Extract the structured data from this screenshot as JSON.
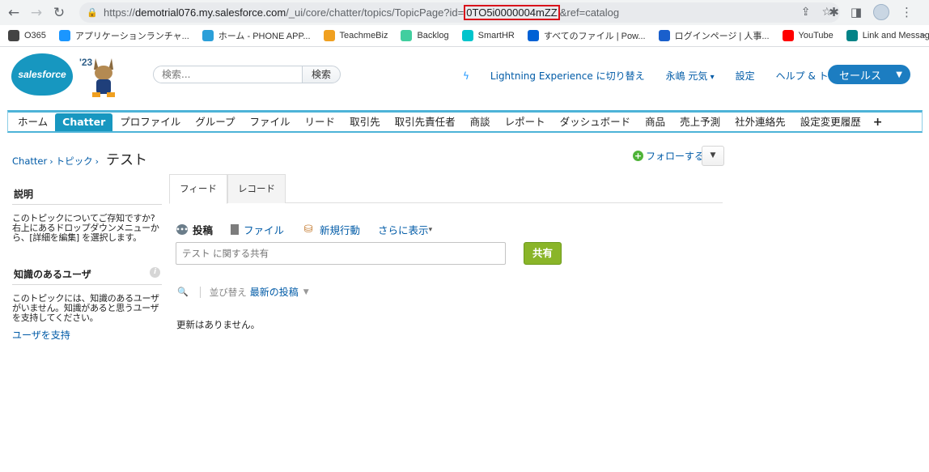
{
  "browser": {
    "url_prefix": "https://",
    "url_host": "demotrial076.my.salesforce.com",
    "url_path": "/_ui/core/chatter/topics/TopicPage?id=",
    "url_id": "0TO5i0000004mZZ",
    "url_suffix": "&ref=catalog"
  },
  "bookmarks": [
    {
      "label": "O365",
      "icon": "office-icon",
      "color": "#444444"
    },
    {
      "label": "アプリケーションランチャ...",
      "icon": "cloud-icon",
      "color": "#1b96ff"
    },
    {
      "label": "ホーム - PHONE APP...",
      "icon": "grid-icon",
      "color": "#2b9fd9"
    },
    {
      "label": "TeachmeBiz",
      "icon": "teachme-icon",
      "color": "#f0a020"
    },
    {
      "label": "Backlog",
      "icon": "backlog-icon",
      "color": "#42ce9f"
    },
    {
      "label": "SmartHR",
      "icon": "smarthr-icon",
      "color": "#00c4cc"
    },
    {
      "label": "すべてのファイル | Pow...",
      "icon": "box-icon",
      "color": "#0061d5"
    },
    {
      "label": "ログインページ | 人事...",
      "icon": "arrow-icon",
      "color": "#1a5fcc"
    },
    {
      "label": "YouTube",
      "icon": "youtube-icon",
      "color": "#ff0000"
    },
    {
      "label": "Link and Message P...",
      "icon": "sharepoint-icon",
      "color": "#038387"
    }
  ],
  "header": {
    "logo_text": "salesforce",
    "year": "'23",
    "search_placeholder": "検索...",
    "search_button": "検索",
    "lightning_link": "Lightning Experience に切り替え",
    "user_name": "永嶋 元気",
    "settings": "設定",
    "help": "ヘルプ & トレーニング",
    "app_name": "セールス"
  },
  "tabs": [
    "ホーム",
    "Chatter",
    "プロファイル",
    "グループ",
    "ファイル",
    "リード",
    "取引先",
    "取引先責任者",
    "商談",
    "レポート",
    "ダッシュボード",
    "商品",
    "売上予測",
    "社外連絡先",
    "設定変更履歴"
  ],
  "active_tab": "Chatter",
  "breadcrumb": {
    "crumb1": "Chatter",
    "crumb2": "トピック",
    "sep": "›",
    "title": "テスト"
  },
  "follow_label": "フォローする",
  "sidebar": {
    "desc_title": "説明",
    "desc_text": "このトピックについてご存知ですか? 右上にあるドロップダウンメニューから、[詳細を編集] を選択します。",
    "knowledge_title": "知識のあるユーザ",
    "knowledge_text": "このトピックには、知識のあるユーザがいません。知識があると思うユーザを支持してください。",
    "support_link": "ユーザを支持"
  },
  "view_tabs": {
    "feed": "フィード",
    "records": "レコード"
  },
  "publisher": {
    "post": "投稿",
    "file": "ファイル",
    "new_action": "新規行動",
    "more": "さらに表示",
    "placeholder": "テスト に関する共有",
    "share": "共有"
  },
  "sort": {
    "label": "並び替え",
    "value": "最新の投稿"
  },
  "empty_message": "更新はありません。"
}
